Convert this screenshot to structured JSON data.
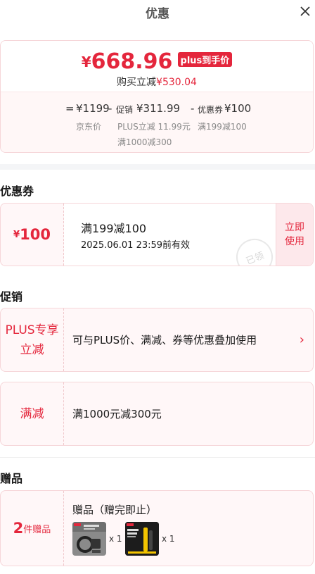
{
  "header": {
    "title": "优惠"
  },
  "summary": {
    "currency": "¥",
    "final_price": "668.96",
    "price_tag": "plus到手价",
    "saving_label": "购买立减",
    "saving_value": "¥530.04",
    "calc": {
      "eq": "=",
      "base": "¥1199",
      "minus1": "-",
      "promo_label": "促销",
      "promo_value": "¥311.99",
      "minus2": "-",
      "coupon_label": "优惠券",
      "coupon_value": "¥100",
      "base_sub": "京东价",
      "promo_sub1": "PLUS立减 11.99元",
      "promo_sub2": "满1000减300",
      "coupon_sub": "满199减100"
    }
  },
  "coupons": {
    "title": "优惠券",
    "item": {
      "symbol": "¥",
      "value": "100",
      "condition": "满199减100",
      "expiry": "2025.06.01 23:59前有效",
      "stamp": "已领",
      "action": "立即\n使用"
    }
  },
  "promotions": {
    "title": "促销",
    "items": [
      {
        "tag": "PLUS专享\n立减",
        "text": "可与PLUS价、满减、券等优惠叠加使用",
        "arrow": "›"
      },
      {
        "tag": "满减",
        "text": "满1000元减300元"
      }
    ]
  },
  "gifts": {
    "title": "赠品",
    "count": "2",
    "count_label": "件赠品",
    "heading": "赠品（赠完即止）",
    "items": [
      {
        "name": "gift-item-1",
        "qty": "x 1"
      },
      {
        "name": "gift-item-2",
        "qty": "x 1"
      }
    ]
  },
  "colors": {
    "accent": "#e4263c",
    "card_bg": "#fff7f8",
    "border": "#f6d6d9"
  }
}
